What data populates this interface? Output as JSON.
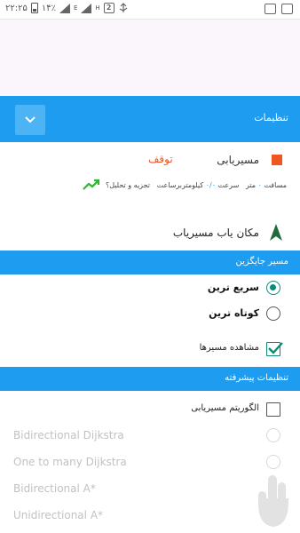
{
  "status_bar": {
    "time": "۲۲:۲۵",
    "battery": "۱۴٪",
    "network_e": "E",
    "network_h": "H",
    "sim_slot": "2"
  },
  "header": {
    "title": "تنظیمات"
  },
  "route": {
    "label": "مسیریابی",
    "status": "توقف",
    "status_color": "#f0561f"
  },
  "stats": {
    "distance_label": "مسافت",
    "distance_value": "۰",
    "distance_unit": "متر",
    "speed_label": "سرعت",
    "speed_value": "۰/۰",
    "speed_unit": "کیلومتربرساعت",
    "analysis_label": "تجزیه و تحلیل؟"
  },
  "locator": {
    "label": "مکان یاب مسیریاب"
  },
  "preferred_route": {
    "header": "مسیر جایگزین",
    "options": [
      {
        "label": "سریع ترین",
        "checked": true
      },
      {
        "label": "کوتاه ترین",
        "checked": false
      }
    ],
    "show_routes_label": "مشاهده مسیرها",
    "show_routes_checked": true
  },
  "advanced": {
    "header": "تنظیمات پیشرفته",
    "algorithm_label": "الگوریتم مسیریابی",
    "algorithm_checked": false,
    "algorithms": [
      "Bidirectional Dijkstra",
      "One to many Dijkstra",
      "Bidirectional A*",
      "Unidirectional A*"
    ]
  },
  "colors": {
    "primary": "#1e9cf0",
    "accent": "#f0561f",
    "checked": "#0c8a77"
  }
}
